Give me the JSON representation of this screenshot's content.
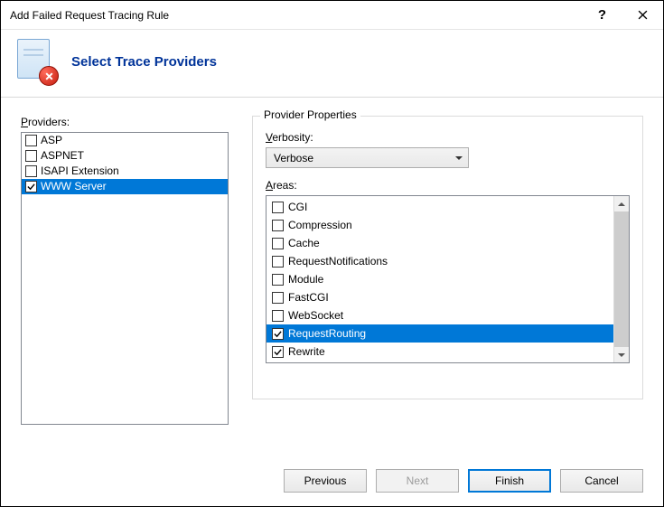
{
  "window": {
    "title": "Add Failed Request Tracing Rule"
  },
  "header": {
    "title": "Select Trace Providers"
  },
  "providers": {
    "label": "Providers:",
    "items": [
      {
        "label": "ASP",
        "checked": false,
        "selected": false
      },
      {
        "label": "ASPNET",
        "checked": false,
        "selected": false
      },
      {
        "label": "ISAPI Extension",
        "checked": false,
        "selected": false
      },
      {
        "label": "WWW Server",
        "checked": true,
        "selected": true
      }
    ]
  },
  "properties": {
    "legend": "Provider Properties",
    "verbosity_label": "Verbosity:",
    "verbosity_value": "Verbose",
    "areas_label": "Areas:",
    "areas": [
      {
        "label": "CGI",
        "checked": false,
        "selected": false
      },
      {
        "label": "Compression",
        "checked": false,
        "selected": false
      },
      {
        "label": "Cache",
        "checked": false,
        "selected": false
      },
      {
        "label": "RequestNotifications",
        "checked": false,
        "selected": false
      },
      {
        "label": "Module",
        "checked": false,
        "selected": false
      },
      {
        "label": "FastCGI",
        "checked": false,
        "selected": false
      },
      {
        "label": "WebSocket",
        "checked": false,
        "selected": false
      },
      {
        "label": "RequestRouting",
        "checked": true,
        "selected": true
      },
      {
        "label": "Rewrite",
        "checked": true,
        "selected": false
      }
    ]
  },
  "buttons": {
    "previous": "Previous",
    "next": "Next",
    "finish": "Finish",
    "cancel": "Cancel"
  }
}
